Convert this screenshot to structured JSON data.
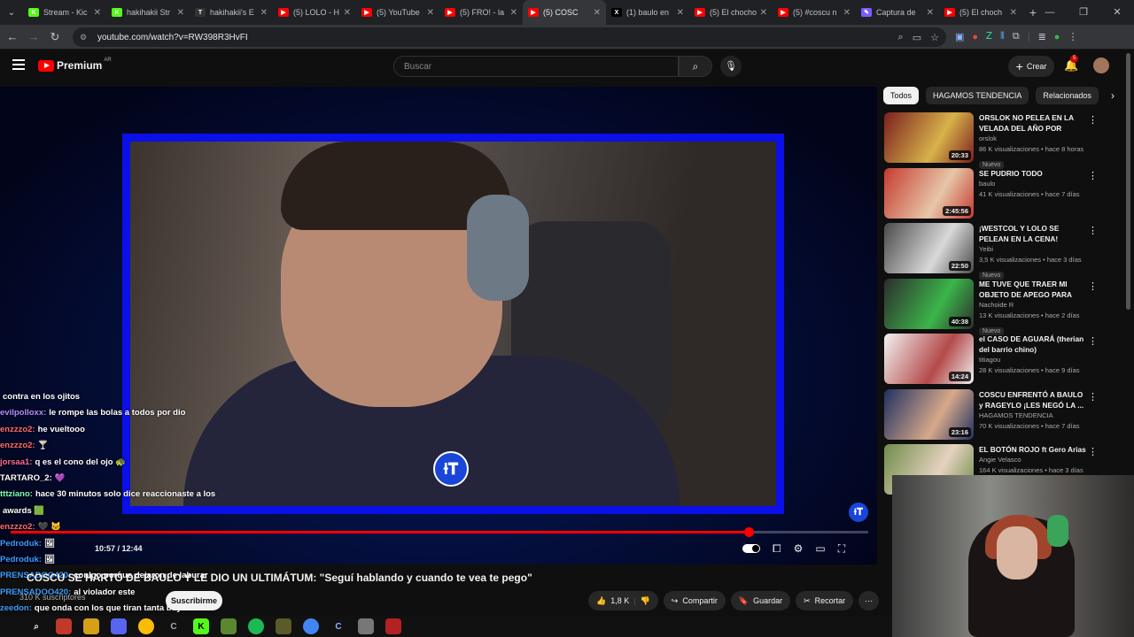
{
  "browser": {
    "tabs": [
      {
        "label": "Stream - Kic",
        "fav_color": "#53fc18",
        "fav_char": "K"
      },
      {
        "label": "hakihakii Str",
        "fav_color": "#53fc18",
        "fav_char": "K"
      },
      {
        "label": "hakihakii's E",
        "fav_color": "#333333",
        "fav_char": "T"
      },
      {
        "label": "(5) LOLO - H",
        "fav_color": "#ff0000",
        "fav_char": "▶"
      },
      {
        "label": "(5) YouTube",
        "fav_color": "#ff0000",
        "fav_char": "▶"
      },
      {
        "label": "(5) FRO! - la",
        "fav_color": "#ff0000",
        "fav_char": "▶"
      },
      {
        "label": "(5) COSC",
        "fav_color": "#ff0000",
        "fav_char": "▶",
        "active": true
      },
      {
        "label": "(1) baulo en",
        "fav_color": "#000000",
        "fav_char": "X"
      },
      {
        "label": "(5) El chocho",
        "fav_color": "#ff0000",
        "fav_char": "▶"
      },
      {
        "label": "(5) #coscu n",
        "fav_color": "#ff0000",
        "fav_char": "▶"
      },
      {
        "label": "Captura de",
        "fav_color": "#7b5cff",
        "fav_char": "✎"
      },
      {
        "label": "(5) El choch",
        "fav_color": "#ff0000",
        "fav_char": "▶"
      }
    ],
    "url": "youtube.com/watch?v=RW398R3HvFI"
  },
  "header": {
    "logo_text": "Premium",
    "country": "AR",
    "search_placeholder": "Buscar",
    "create_label": "Crear",
    "notif_count": "5"
  },
  "chat": [
    {
      "user": "",
      "text": "contra en los ojitos",
      "color": "#aaaaaa"
    },
    {
      "user": "evilpolloxx:",
      "text": "le rompe las bolas a todos por dio",
      "color": "#b58cff"
    },
    {
      "user": "enzzzo2:",
      "text": "he vueltooo",
      "color": "#ff6b6b"
    },
    {
      "user": "enzzzo2:",
      "text": "🍸",
      "color": "#ff6b6b"
    },
    {
      "user": "jorsaa1:",
      "text": "q es el cono del ojo 🐢",
      "color": "#ff6b8b"
    },
    {
      "user": "TARTARO_2:",
      "text": "💜",
      "color": "#ffffff"
    },
    {
      "user": "tttziano:",
      "text": "hace 30 minutos solo dice reaccionaste a los",
      "color": "#7cffb2"
    },
    {
      "user": "",
      "text": "awards 🟩",
      "color": "#ffffff"
    },
    {
      "user": "enzzzo2:",
      "text": "🖤 🐱",
      "color": "#ff6b6b"
    },
    {
      "user": "Pedroduk:",
      "text": "🖼",
      "color": "#3d9bff"
    },
    {
      "user": "Pedroduk:",
      "text": "🖼",
      "color": "#3d9bff"
    },
    {
      "user": "PRENSADOO420:",
      "text": "conlgo porque dejaron de laburar",
      "color": "#3d9bff"
    },
    {
      "user": "PRENSADOO420:",
      "text": "al violador este",
      "color": "#3d9bff"
    },
    {
      "user": "zeedon:",
      "text": "que onda con los que tiran tanta buyit",
      "color": "#3d9bff"
    }
  ],
  "player": {
    "time": "10:57 / 12:44",
    "progress_fraction": 0.861,
    "watermark": "Ɨ𝐓"
  },
  "video": {
    "title": "COSCU SE HARTÓ DE BAULO Y LE DIO UN ULTIMÁTUM: \"Seguí hablando y cuando te vea te pego\"",
    "subscribers": "310 K suscriptores",
    "subscribe_label": "Suscribirme",
    "likes": "1,8 K",
    "share_label": "Compartir",
    "save_label": "Guardar",
    "clip_label": "Recortar"
  },
  "chips": [
    "Todos",
    "HAGAMOS TENDENCIA",
    "Relacionados"
  ],
  "recommendations": [
    {
      "title": "ORSLOK NO PELEA EN LA VELADA DEL AÑO POR ESTO...",
      "channel": "orslok",
      "meta": "86 K visualizaciones • hace 8 horas",
      "duration": "20:33",
      "nuevo": "Nuevo",
      "c1": "#7a1f1f",
      "c2": "#d8b24a"
    },
    {
      "title": "SE PUDRIO TODO",
      "channel": "baulo",
      "meta": "41 K visualizaciones • hace 7 días",
      "duration": "2:45:56",
      "nuevo": "",
      "c1": "#c43b2f",
      "c2": "#e7c6a8"
    },
    {
      "title": "¡WESTCOL Y LOLO SE PELEAN EN LA CENA!",
      "channel": "Yeibi",
      "meta": "3,5 K visualizaciones • hace 3 días",
      "duration": "22:50",
      "nuevo": "Nuevo",
      "c1": "#4a4a4a",
      "c2": "#d9d9d9"
    },
    {
      "title": "ME TUVE QUE TRAER MI OBJETO DE APEGO PARA VER...",
      "channel": "Nachoide R",
      "meta": "13 K visualizaciones • hace 2 días",
      "duration": "40:38",
      "nuevo": "Nuevo",
      "c1": "#2d2d2d",
      "c2": "#3bb54a"
    },
    {
      "title": "el CASO DE AGUARÁ (therian del barrio chino)",
      "channel": "titiagou",
      "meta": "28 K visualizaciones • hace 9 días",
      "duration": "14:24",
      "nuevo": "",
      "c1": "#f2f2f2",
      "c2": "#b44a4a"
    },
    {
      "title": "COSCU ENFRENTÓ A BAULO y RAGEYLO ¡LES NEGÓ LA ...",
      "channel": "HAGAMOS TENDENCIA",
      "meta": "70 K visualizaciones • hace 7 días",
      "duration": "23:16",
      "nuevo": "",
      "c1": "#203060",
      "c2": "#d7a98a"
    },
    {
      "title": "EL BOTÓN ROJO ft Gero Arias",
      "channel": "Angie Velasco",
      "meta": "164 K visualizaciones • hace 3 días",
      "duration": "",
      "nuevo": "",
      "c1": "#6f8c4a",
      "c2": "#e5d2c0"
    }
  ]
}
